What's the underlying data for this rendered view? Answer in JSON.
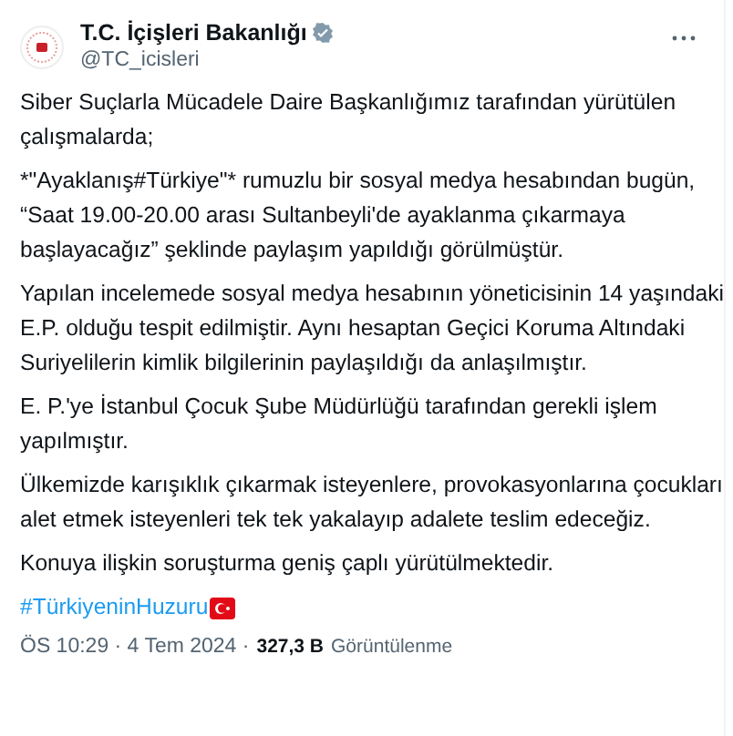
{
  "author": {
    "name": "T.C. İçişleri Bakanlığı",
    "handle": "@TC_icisleri",
    "verified": true
  },
  "paragraphs": [
    {
      "lines": [
        "Siber Suçlarla Mücadele Daire Başkanlığımız tarafından yürütülen",
        "çalışmalarda;"
      ]
    },
    {
      "lines": [
        "*\"Ayaklanış#Türkiye\"* rumuzlu bir sosyal medya hesabından bugün,",
        "“Saat 19.00-20.00 arası Sultanbeyli'de ayaklanma çıkarmaya",
        "başlayacağız” şeklinde paylaşım yapıldığı görülmüştür."
      ]
    },
    {
      "lines": [
        "Yapılan incelemede sosyal medya hesabının yöneticisinin 14 yaşındaki",
        "E.P. olduğu tespit edilmiştir. Aynı hesaptan Geçici Koruma Altındaki",
        "Suriyelilerin kimlik bilgilerinin paylaşıldığı da anlaşılmıştır."
      ]
    },
    {
      "lines": [
        "E. P.'ye İstanbul Çocuk Şube Müdürlüğü tarafından gerekli işlem",
        "yapılmıştır."
      ]
    },
    {
      "lines": [
        "Ülkemizde karışıklık çıkarmak isteyenlere, provokasyonlarına çocukları",
        "alet etmek isteyenleri tek tek yakalayıp adalete teslim edeceğiz."
      ]
    },
    {
      "lines": [
        "Konuya ilişkin soruşturma geniş çaplı yürütülmektedir."
      ]
    }
  ],
  "hashtag": "#TürkiyeninHuzuru",
  "meta": {
    "time": "ÖS 10:29 · 4 Tem 2024 ·",
    "views": "327,3 B",
    "views_label": "Görüntülenme"
  }
}
